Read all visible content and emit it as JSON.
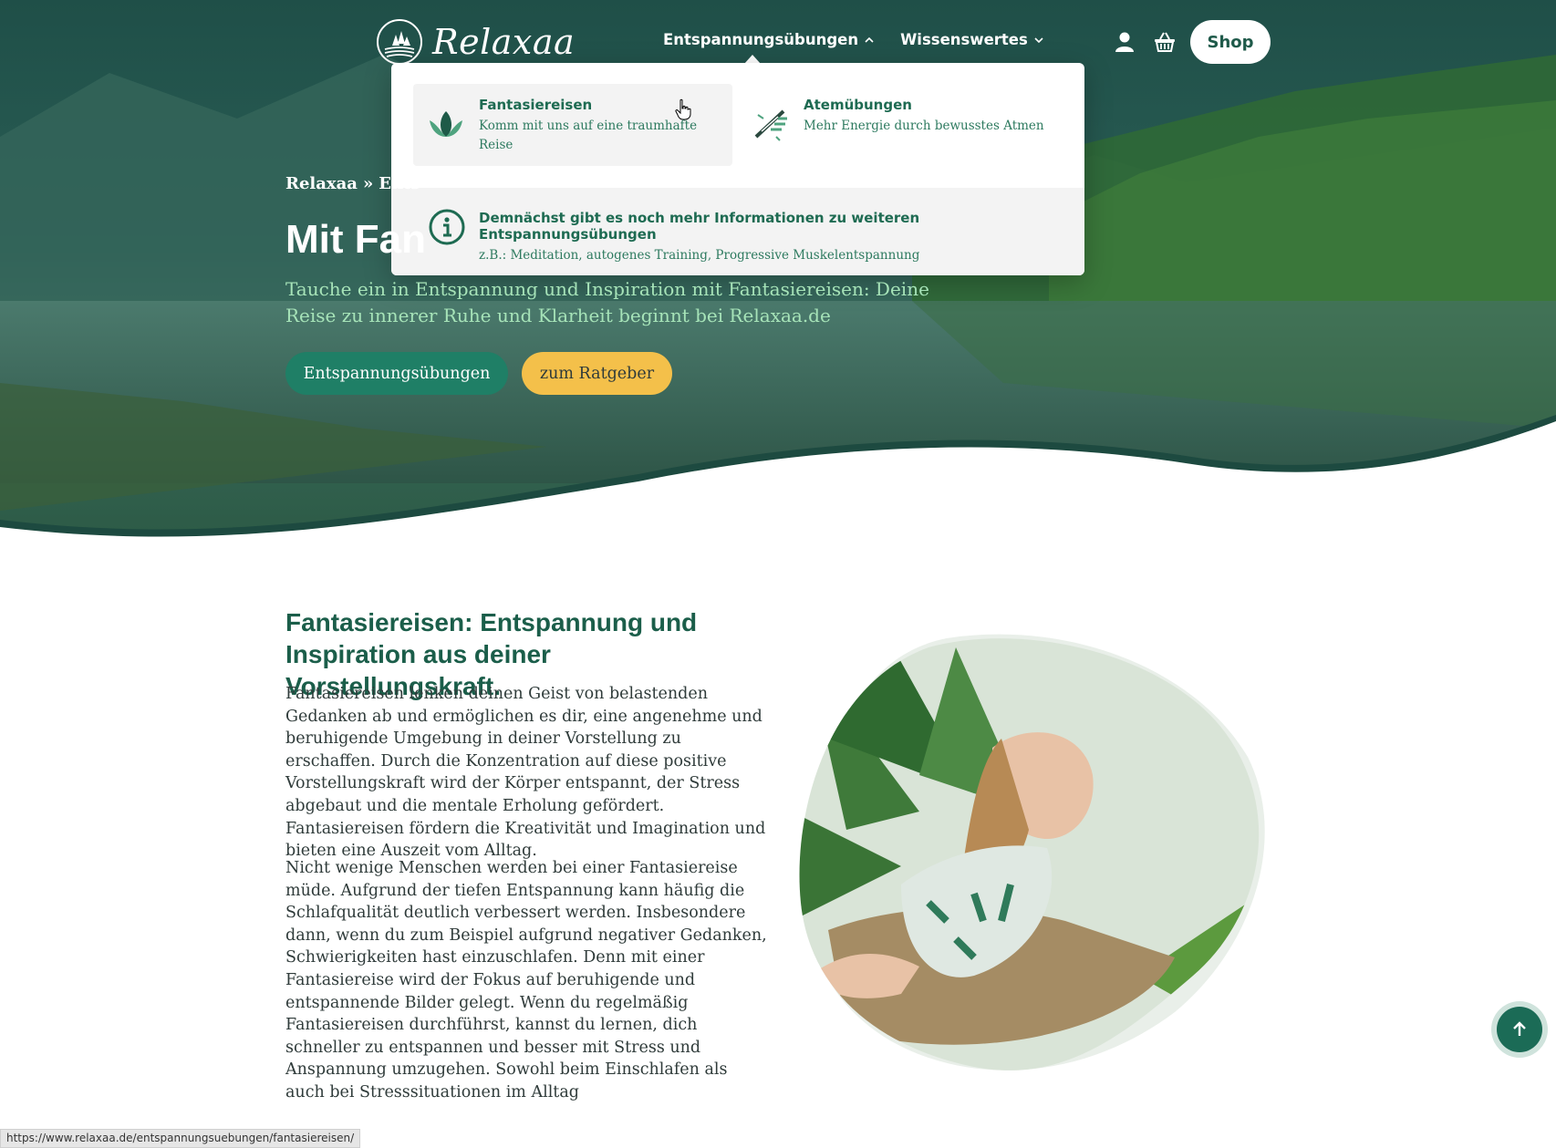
{
  "brand": {
    "name": "Relaxaa"
  },
  "nav": {
    "items": [
      {
        "label": "Entspannungsübungen",
        "expanded": true
      },
      {
        "label": "Wissenswertes",
        "expanded": false
      }
    ],
    "shop_label": "Shop"
  },
  "dropdown": {
    "cards": [
      {
        "title": "Fantasiereisen",
        "desc_line1": "Komm mit uns auf eine traumhafte",
        "desc_line2": "Reise",
        "icon": "lotus-leaf-icon",
        "hovered": true
      },
      {
        "title": "Atemübungen",
        "desc_line1": "Mehr Energie durch bewusstes Atmen",
        "icon": "breathing-icon",
        "hovered": false
      }
    ],
    "info": {
      "title": "Demnächst gibt es noch mehr Informationen zu weiteren Entspannungsübungen",
      "desc": "z.B.: Meditation, autogenes Training, Progressive Muskelentspannung",
      "icon": "info-icon"
    }
  },
  "hero": {
    "breadcrumb": [
      "Relaxaa",
      "»",
      "Ents"
    ],
    "title": "Mit Fan",
    "subtitle": "Tauche ein in Entspannung und Inspiration mit Fantasiereisen: Deine Reise zu innerer Ruhe und Klarheit beginnt bei Relaxaa.de",
    "btn_primary": "Entspannungsübungen",
    "btn_secondary": "zum Ratgeber"
  },
  "content": {
    "heading_line1": "Fantasiereisen: Entspannung und",
    "heading_line2": "Inspiration aus deiner Vorstellungskraft.",
    "paragraph1": "Fantasiereisen lenken deinen Geist von belastenden Gedanken ab und ermöglichen es dir, eine angenehme und beruhigende Umgebung in deiner Vorstellung zu erschaffen. Durch die Konzentration auf diese positive Vorstellungskraft wird der Körper entspannt, der Stress abgebaut und die mentale Erholung gefördert. Fantasiereisen fördern die Kreativität und Imagination und bieten eine Auszeit vom Alltag.",
    "paragraph2": "Nicht wenige Menschen werden bei einer Fantasiereise müde. Aufgrund der tiefen Entspannung kann häufig die Schlafqualität deutlich verbessert werden. Insbesondere dann, wenn du zum Beispiel aufgrund negativer Gedanken, Schwierigkeiten hast einzuschlafen. Denn mit einer Fantasiereise wird der Fokus auf beruhigende und entspannende Bilder gelegt. Wenn du regelmäßig Fantasiereisen durchführst, kannst du lernen, dich schneller zu entspannen und besser mit Stress und Anspannung umzugehen. Sowohl beim Einschlafen als auch bei Stresssituationen im Alltag"
  },
  "status_url": "https://www.relaxaa.de/entspannungsuebungen/fantasiereisen/",
  "colors": {
    "brand_green": "#1b5e4a",
    "button_green": "#1f7f66",
    "button_yellow": "#f4c04a",
    "subtitle_green": "#a6e3b8"
  }
}
